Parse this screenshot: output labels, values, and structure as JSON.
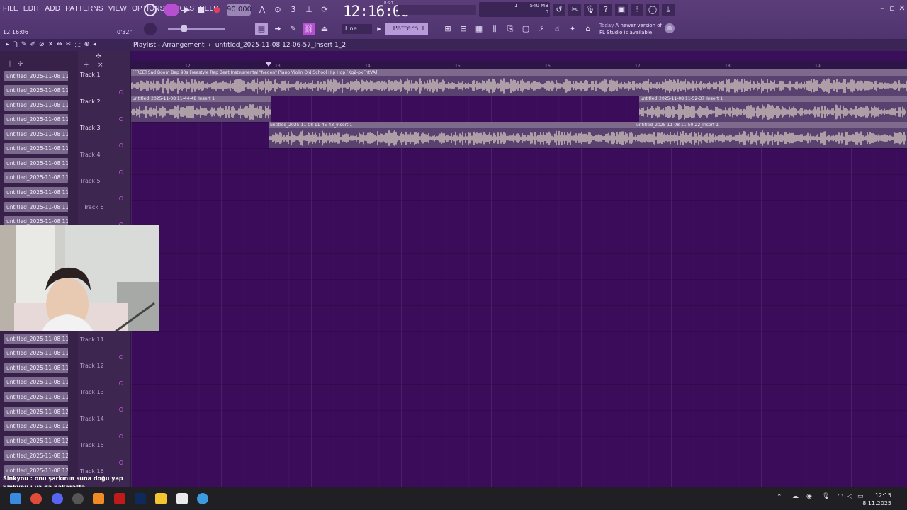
{
  "menu": [
    "FILE",
    "EDIT",
    "ADD",
    "PATTERNS",
    "VIEW",
    "OPTIONS",
    "TOOLS",
    "HELP"
  ],
  "transport": {
    "tempo": "90.000",
    "time": "12:16:00",
    "time_label": "B:S:T"
  },
  "performance": {
    "memory": "540 MB",
    "cpu_left": "1",
    "cpu_right": "0"
  },
  "position": {
    "timecode": "12:16:06",
    "seconds": "0'32\""
  },
  "snap": "Line",
  "pattern": "Pattern 1",
  "news": {
    "today": "Today",
    "message": "A newer version of FL Studio is available!"
  },
  "playlist": {
    "title": "Playlist - Arrangement",
    "breadcrumb": "untitled_2025-11-08 12-06-57_Insert 1_2"
  },
  "ruler": [
    "12",
    "13",
    "14",
    "15",
    "16",
    "17",
    "18",
    "19"
  ],
  "browser": [
    "untitled_2025-11-08 11-...",
    "untitled_2025-11-08 11-...",
    "untitled_2025-11-08 11-...",
    "untitled_2025-11-08 11-...",
    "untitled_2025-11-08 11-...",
    "untitled_2025-11-08 11-...",
    "untitled_2025-11-08 11-...",
    "untitled_2025-11-08 11-...",
    "untitled_2025-11-08 11-...",
    "untitled_2025-11-08 11-...",
    "untitled_2025-11-08 11-...",
    "untitled_2025-11-08 11-...",
    "untitled_2025-11-08 11-...",
    "untitled_2025-11-08 11-...",
    "untitled_2025-11-08 11-...",
    "untitled_2025-11-08 11-...",
    "untitled_2025-11-08 12-...",
    "untitled_2025-11-08 12-...",
    "untitled_2025-11-08 12-...",
    "untitled_2025-11-08 12-...",
    "untitled_2025-11-08 12-..."
  ],
  "tracks": [
    "Track 1",
    "Track 2",
    "Track 3",
    "Track 4",
    "Track 5",
    "Track 6",
    "Track 11",
    "Track 12",
    "Track 13",
    "Track 14",
    "Track 15",
    "Track 16"
  ],
  "clips": {
    "c1": "[FREE] Sad Boom Bap 90s Freestyle Rap Beat Instrumental \"Neden\" Piano Violin Old School Hip Hop [Kq2-pxFntVA]",
    "c2": "untitled_2025-11-08 11-44-48_Insert 1",
    "c3": "untitled_2025-11-08 11-52-37_Insert 1",
    "c4": "untitled_2025-11-08 11-45-43_Insert 1",
    "c5": "untitled_2025-11-08 11-50-22_Insert 1"
  },
  "chat": [
    {
      "user": "Sinkyou",
      "text": "onu şarkının suna doğu yap"
    },
    {
      "user": "Sinkyou",
      "text": "ya da nakaratta"
    }
  ],
  "taskbar": {
    "time": "12:15",
    "date": "8.11.2025"
  }
}
